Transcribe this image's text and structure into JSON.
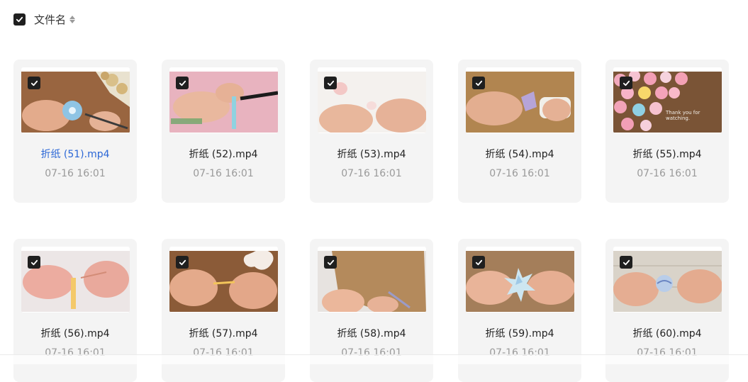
{
  "header": {
    "select_all_checked": true,
    "title": "文件名",
    "sort_icon": "sort-icon"
  },
  "files": [
    {
      "name": "折纸 (51).mp4",
      "date": "07-16 16:01",
      "checked": true,
      "active": true,
      "thumb": "wooden-table-flower"
    },
    {
      "name": "折纸 (52).mp4",
      "date": "07-16 16:01",
      "checked": true,
      "active": false,
      "thumb": "pink-background-hands"
    },
    {
      "name": "折纸 (53).mp4",
      "date": "07-16 16:01",
      "checked": true,
      "active": false,
      "thumb": "white-background-flower"
    },
    {
      "name": "折纸 (54).mp4",
      "date": "07-16 16:01",
      "checked": true,
      "active": false,
      "thumb": "cork-background-glue"
    },
    {
      "name": "折纸 (55).mp4",
      "date": "07-16 16:01",
      "checked": true,
      "active": false,
      "thumb": "paper-roses",
      "thumb_text": "Thank you for watching."
    },
    {
      "name": "折纸 (56).mp4",
      "date": "07-16 16:01",
      "checked": true,
      "active": false,
      "thumb": "pink-strip-hands"
    },
    {
      "name": "折纸 (57).mp4",
      "date": "07-16 16:01",
      "checked": true,
      "active": false,
      "thumb": "wood-hands-heart"
    },
    {
      "name": "折纸 (58).mp4",
      "date": "07-16 16:01",
      "checked": true,
      "active": false,
      "thumb": "cardboard-scissors"
    },
    {
      "name": "折纸 (59).mp4",
      "date": "07-16 16:01",
      "checked": true,
      "active": false,
      "thumb": "paper-star"
    },
    {
      "name": "折纸 (60).mp4",
      "date": "07-16 16:01",
      "checked": true,
      "active": false,
      "thumb": "paper-ball"
    }
  ],
  "colors": {
    "accent_link": "#2b67d6",
    "card_bg": "#f4f4f4",
    "checkbox": "#1f1f1f",
    "date_gray": "#9a9a9a"
  }
}
